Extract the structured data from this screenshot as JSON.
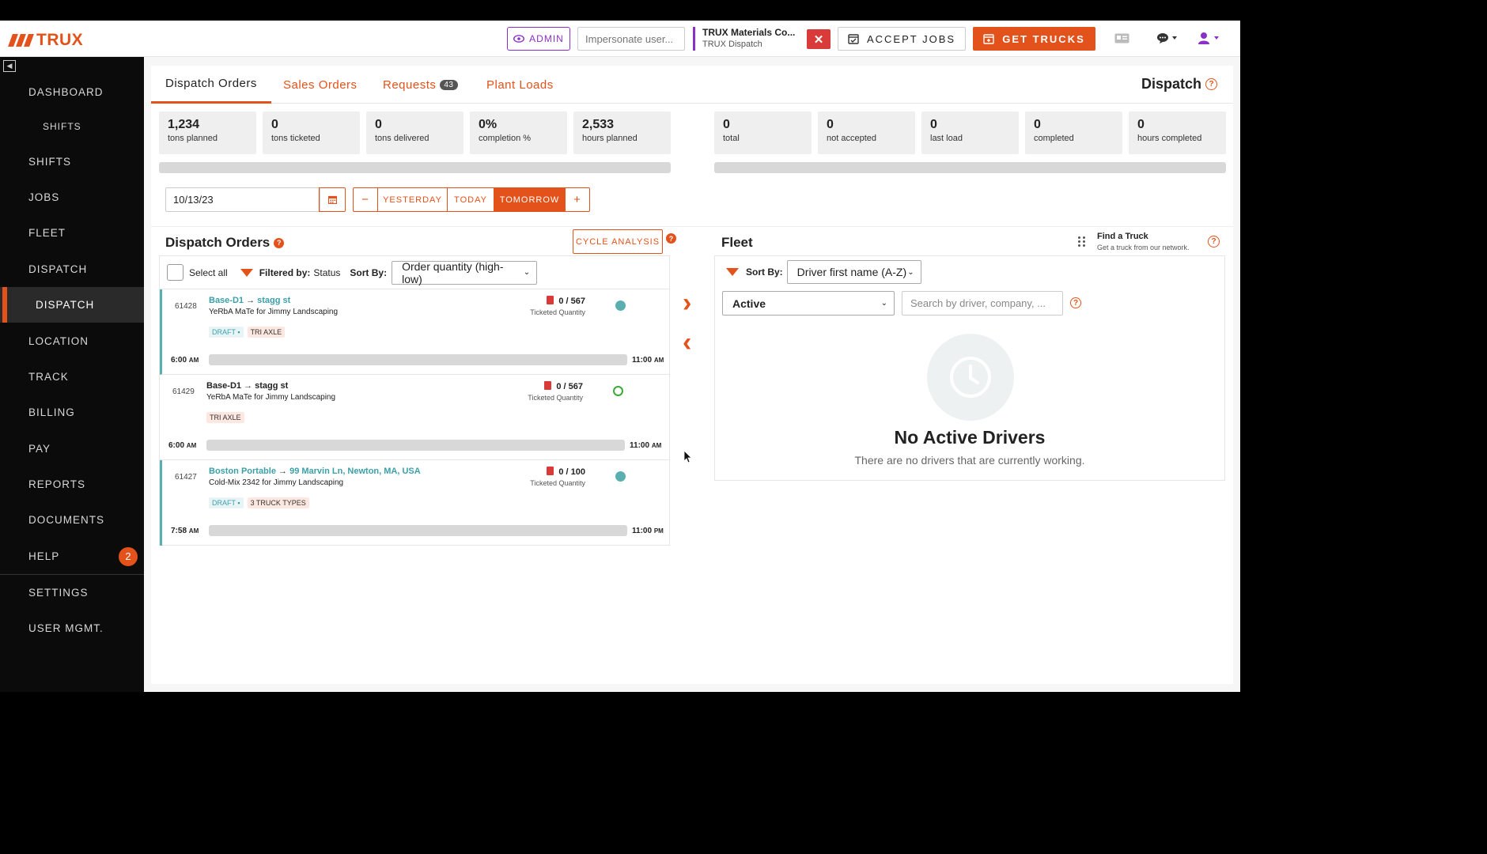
{
  "brand": {
    "name": "TRUX",
    "accent": "#e4521b",
    "admin_color": "#8b2fc9"
  },
  "header": {
    "admin_label": "ADMIN",
    "impersonate_placeholder": "Impersonate user...",
    "company_name": "TRUX Materials Co...",
    "company_sub": "TRUX Dispatch",
    "close_label": "✕",
    "accept_jobs_label": "ACCEPT JOBS",
    "get_trucks_label": "GET TRUCKS"
  },
  "sidebar": {
    "items": [
      {
        "label": "DASHBOARD"
      },
      {
        "label": "SHIFTS"
      },
      {
        "label": "SHIFTS"
      },
      {
        "label": "JOBS"
      },
      {
        "label": "FLEET"
      },
      {
        "label": "DISPATCH"
      },
      {
        "label": "DISPATCH"
      },
      {
        "label": "LOCATION"
      },
      {
        "label": "TRACK"
      },
      {
        "label": "BILLING"
      },
      {
        "label": "PAY"
      },
      {
        "label": "REPORTS"
      },
      {
        "label": "DOCUMENTS"
      },
      {
        "label": "HELP",
        "badge": "2"
      },
      {
        "label": "SETTINGS"
      },
      {
        "label": "USER MGMT."
      }
    ]
  },
  "tabs": [
    {
      "label": "Dispatch Orders"
    },
    {
      "label": "Sales Orders"
    },
    {
      "label": "Requests",
      "badge": "43"
    },
    {
      "label": "Plant Loads"
    }
  ],
  "page_title": "Dispatch",
  "stats_left": [
    {
      "value": "1,234",
      "label": "tons planned"
    },
    {
      "value": "0",
      "label": "tons ticketed"
    },
    {
      "value": "0",
      "label": "tons delivered"
    },
    {
      "value": "0%",
      "label": "completion %"
    },
    {
      "value": "2,533",
      "label": "hours planned"
    }
  ],
  "stats_right": [
    {
      "value": "0",
      "label": "total"
    },
    {
      "value": "0",
      "label": "not accepted"
    },
    {
      "value": "0",
      "label": "last load"
    },
    {
      "value": "0",
      "label": "completed"
    },
    {
      "value": "0",
      "label": "hours completed"
    }
  ],
  "date": {
    "value": "10/13/23",
    "minus": "−",
    "yesterday": "YESTERDAY",
    "today": "TODAY",
    "tomorrow": "TOMORROW",
    "plus": "+"
  },
  "orders_section": {
    "title": "Dispatch Orders",
    "cycle_analysis": "CYCLE ANALYSIS",
    "select_all": "Select all",
    "filtered_by_label": "Filtered by:",
    "filtered_by_value": "Status",
    "sort_by_label": "Sort By:",
    "sort_value": "Order quantity (high-low)",
    "orders": [
      {
        "id": "61428",
        "from": "Base-D1",
        "to": "stagg st",
        "desc": "YeRbA MaTe for Jimmy Landscaping",
        "tags": [
          "DRAFT",
          "TRI AXLE"
        ],
        "qty": "0 / 567",
        "qty_label": "Ticketed Quantity",
        "start": "6:00",
        "start_ampm": "AM",
        "end": "11:00",
        "end_ampm": "AM"
      },
      {
        "id": "61429",
        "from": "Base-D1",
        "to": "stagg st",
        "desc": "YeRbA MaTe for Jimmy Landscaping",
        "tags": [
          "TRI AXLE"
        ],
        "qty": "0 / 567",
        "qty_label": "Ticketed Quantity",
        "start": "6:00",
        "start_ampm": "AM",
        "end": "11:00",
        "end_ampm": "AM"
      },
      {
        "id": "61427",
        "from": "Boston Portable",
        "to": "99 Marvin Ln, Newton, MA, USA",
        "desc": "Cold-Mix 2342 for Jimmy Landscaping",
        "tags": [
          "DRAFT",
          "3 TRUCK TYPES"
        ],
        "qty": "0 / 100",
        "qty_label": "Ticketed Quantity",
        "start": "7:58",
        "start_ampm": "AM",
        "end": "11:00",
        "end_ampm": "PM"
      }
    ]
  },
  "fleet_section": {
    "title": "Fleet",
    "find_truck": "Find a Truck",
    "find_truck_sub": "Get a truck from our network.",
    "sort_by_label": "Sort By:",
    "sort_value": "Driver first name (A-Z)",
    "status_value": "Active",
    "search_placeholder": "Search by driver, company, ...",
    "empty_title": "No Active Drivers",
    "empty_sub": "There are no drivers that are currently working."
  }
}
